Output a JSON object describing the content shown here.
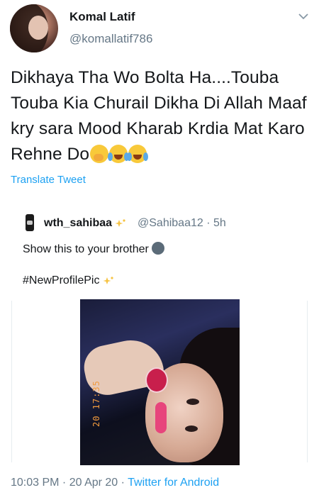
{
  "author": {
    "name": "Komal Latif",
    "handle": "@komallatif786"
  },
  "tweet": {
    "text": "Dikhaya Tha Wo Bolta Ha....Touba Touba Kia Churail Dikha Di Allah Maaf kry sara Mood Kharab Krdia Mat Karo Rehne Do",
    "emojis": [
      "shushing-face-icon",
      "tears-of-joy-icon",
      "tears-of-joy-icon"
    ],
    "translate_label": "Translate Tweet"
  },
  "quoted": {
    "name": "wth_sahibaa",
    "handle_time": "@Sahibaa12 · 5h",
    "text": "Show this to your brother",
    "hashtag": "#NewProfilePic",
    "image_timestamp": "20 17:35"
  },
  "meta": {
    "time": "10:03 PM · 20 Apr 20 · ",
    "via": "Twitter for Android"
  },
  "colors": {
    "link": "#1da1f2",
    "secondary": "#657786",
    "primary_text": "#14171a"
  }
}
